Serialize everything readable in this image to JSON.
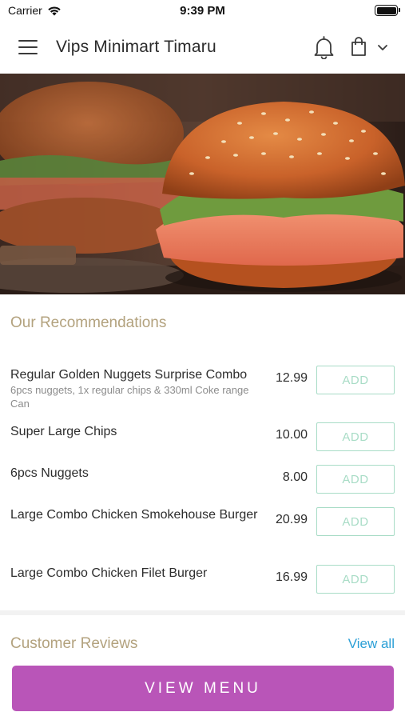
{
  "status_bar": {
    "carrier": "Carrier",
    "time": "9:39 PM"
  },
  "header": {
    "title": "Vips Minimart Timaru"
  },
  "recommendations": {
    "title": "Our Recommendations",
    "items": [
      {
        "name": "Regular Golden Nuggets Surprise Combo",
        "description": "6pcs nuggets, 1x regular chips & 330ml Coke range Can",
        "price": "12.99",
        "button": "ADD"
      },
      {
        "name": "Super Large Chips",
        "description": "",
        "price": "10.00",
        "button": "ADD"
      },
      {
        "name": "6pcs Nuggets",
        "description": "",
        "price": "8.00",
        "button": "ADD"
      },
      {
        "name": "Large Combo Chicken Smokehouse Burger",
        "description": "",
        "price": "20.99",
        "button": "ADD"
      },
      {
        "name": "Large Combo Chicken Filet Burger",
        "description": "",
        "price": "16.99",
        "button": "ADD"
      }
    ]
  },
  "reviews": {
    "title": "Customer Reviews",
    "view_all": "View all"
  },
  "footer": {
    "view_menu": "VIEW MENU"
  },
  "colors": {
    "accent_purple": "#b955b8",
    "section_title": "#b3a27e",
    "add_button": "#a8dcc6",
    "link": "#2a9fd6"
  },
  "icons": [
    "wifi-icon",
    "battery-icon",
    "menu-icon",
    "bell-icon",
    "shopping-bag-icon",
    "chevron-down-icon"
  ]
}
